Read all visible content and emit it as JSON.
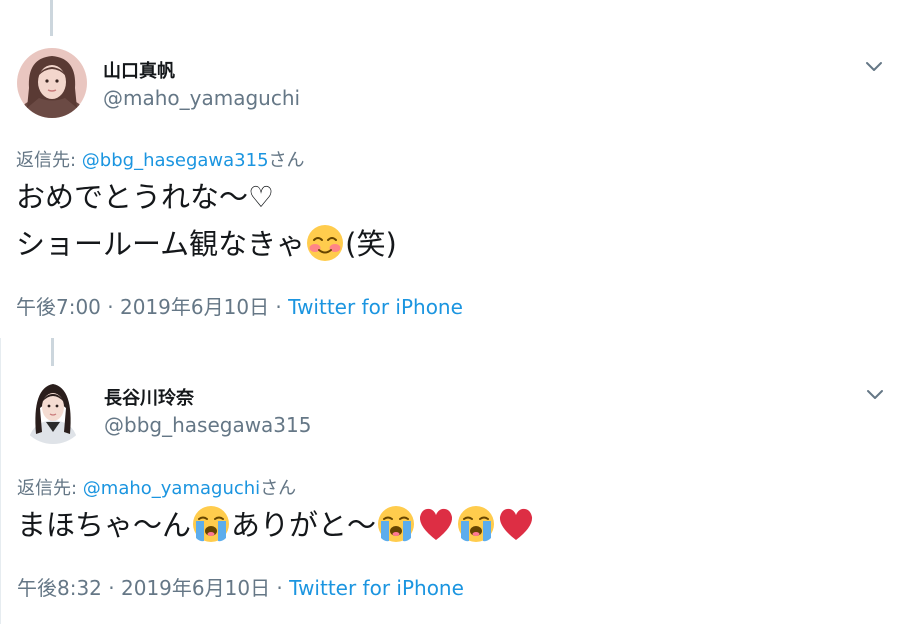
{
  "tweets": [
    {
      "display_name": "山口真帆",
      "handle": "@maho_yamaguchi",
      "reply_prefix": "返信先: ",
      "reply_mention": "@bbg_hasegawa315",
      "reply_suffix": "さん",
      "line1": "おめでとうれな〜♡",
      "line2_text": "ショールーム観なきゃ",
      "line2_emoji": "smiling-face-emoji",
      "line2_tail": "(笑)",
      "time": "午後7:00",
      "sep1": " · ",
      "date": "2019年6月10日",
      "sep2": " · ",
      "source": "Twitter for iPhone"
    },
    {
      "display_name": "長谷川玲奈",
      "handle": "@bbg_hasegawa315",
      "reply_prefix": "返信先: ",
      "reply_mention": "@maho_yamaguchi",
      "reply_suffix": "さん",
      "text_a": "まほちゃ〜ん",
      "text_b": "ありがと〜",
      "emojis": [
        "loudly-crying-face-emoji",
        "red-heart-emoji",
        "loudly-crying-face-emoji",
        "red-heart-emoji"
      ],
      "time": "午後8:32",
      "sep1": " · ",
      "date": "2019年6月10日",
      "sep2": " · ",
      "source": "Twitter for iPhone"
    }
  ],
  "colors": {
    "text": "#14171a",
    "secondary": "#657786",
    "link": "#1b95e0",
    "thread_line": "#ccd6dd"
  },
  "icons": [
    "chevron-down-icon",
    "smiling-face-emoji",
    "loudly-crying-face-emoji",
    "red-heart-emoji"
  ]
}
